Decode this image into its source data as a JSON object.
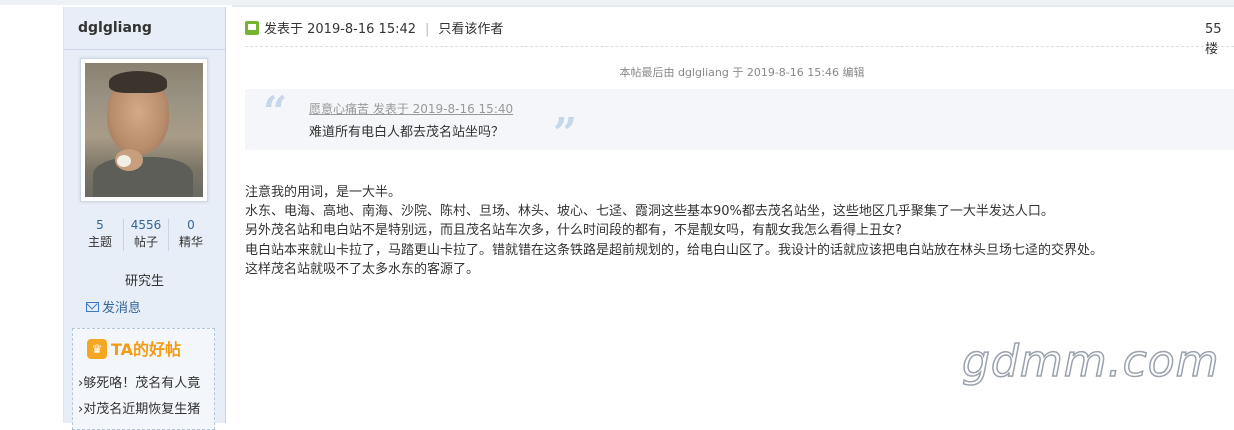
{
  "sidebar": {
    "username": "dglgliang",
    "stats": [
      {
        "value": "5",
        "label": "主题"
      },
      {
        "value": "4556",
        "label": "帖子"
      },
      {
        "value": "0",
        "label": "精华"
      }
    ],
    "rank": "研究生",
    "message_label": "发消息",
    "ta_title": "TA的好帖",
    "ta_posts": [
      "够死咯！茂名有人竟",
      "对茂名近期恢复生猪"
    ]
  },
  "post": {
    "posted_label": "发表于 2019-8-16 15:42",
    "only_author": "只看该作者",
    "floor": "55楼",
    "edit_note": "本帖最后由 dglgliang 于 2019-8-16 15:46 编辑",
    "quote_author": "愿意心痛苦 发表于 2019-8-16 15:40",
    "quote_text": "难道所有电白人都去茂名站坐吗？",
    "body_lines": [
      "注意我的用词，是一大半。",
      "水东、电海、高地、南海、沙院、陈村、旦场、林头、坡心、七迳、霞洞这些基本90%都去茂名站坐，这些地区几乎聚集了一大半发达人口。",
      "另外茂名站和电白站不是特别远，而且茂名站车次多，什么时间段的都有，不是靓女吗，有靓女我怎么看得上丑女?",
      "电白站本来就山卡拉了，马踏更山卡拉了。错就错在这条铁路是超前规划的，给电白山区了。我设计的话就应该把电白站放在林头旦场七迳的交界处。",
      "这样茂名站就吸不了太多水东的客源了。"
    ]
  },
  "watermark": "gdmm.com"
}
